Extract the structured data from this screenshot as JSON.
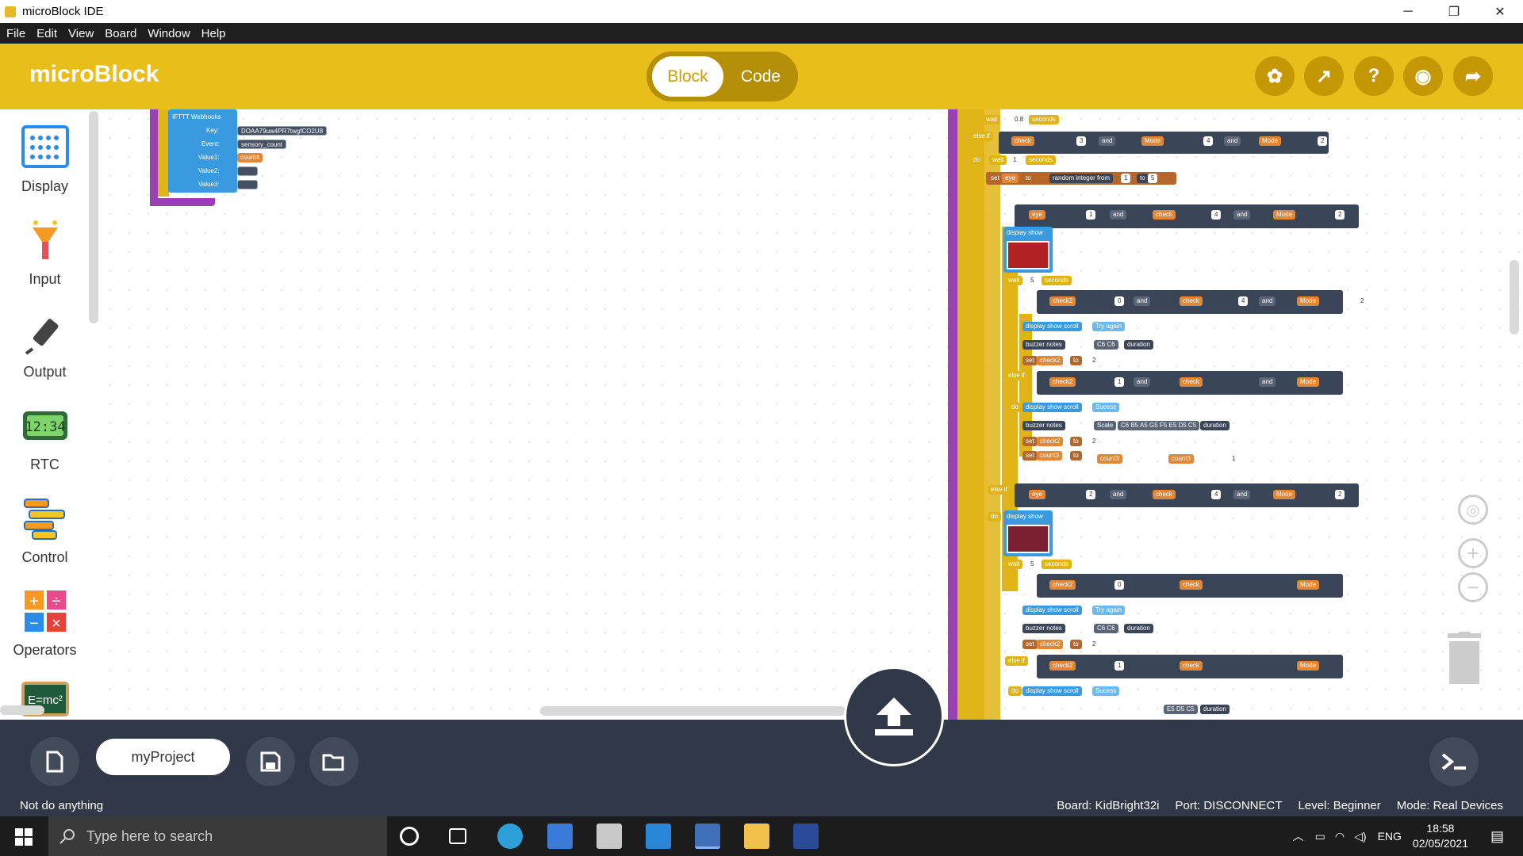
{
  "window": {
    "title": "microBlock IDE",
    "controls": [
      "─",
      "❐",
      "✕"
    ]
  },
  "menu": [
    "File",
    "Edit",
    "View",
    "Board",
    "Window",
    "Help"
  ],
  "header": {
    "logo": "microBlock",
    "mode_block": "Block",
    "mode_code": "Code",
    "tools": [
      "extensions-icon",
      "graph-icon",
      "help-icon",
      "github-icon",
      "share-icon"
    ],
    "tool_glyphs": [
      "✿",
      "↗",
      "?",
      "◉",
      "➦"
    ]
  },
  "palette": [
    {
      "label": "Display",
      "icon": "display-icon"
    },
    {
      "label": "Input",
      "icon": "input-icon"
    },
    {
      "label": "Output",
      "icon": "output-icon"
    },
    {
      "label": "RTC",
      "icon": "rtc-icon",
      "icon_text": "12:34"
    },
    {
      "label": "Control",
      "icon": "control-icon"
    },
    {
      "label": "Operators",
      "icon": "operators-icon"
    },
    {
      "label": "",
      "icon": "math-icon",
      "icon_text": "E=mc²"
    }
  ],
  "blocks": {
    "ifttt": {
      "title": "IFTTT Webhooks",
      "key_label": "Key:",
      "key_value": "DOAA79uw4PR7twgfCO2U8",
      "event_label": "Event:",
      "event_value": "sensory_count",
      "value1_label": "Value1:",
      "value1": "count4",
      "value2_label": "Value2:",
      "value3_label": "Value3:"
    },
    "main": {
      "wait": "wait",
      "seconds": "seconds",
      "wait_value_1": "0.8",
      "else_if": "else if",
      "do": "do",
      "and": "and",
      "set": "set",
      "to": "to",
      "check": "check",
      "mode": "Mode",
      "eye": "eye",
      "check2": "check2",
      "count3": "count3",
      "random": "random integer from",
      "rand_from": "1",
      "rand_to": "5",
      "display_show": "display show",
      "display_show_scroll": "display show scroll",
      "buzzer_notes": "buzzer notes",
      "duration": "duration",
      "try_again": "Try again",
      "sucess": "Sucess",
      "notes_1": "C6 C6",
      "notes_scale": "Scale",
      "notes_2": "C6 B5 A5 G5 F5 E5 D5 C5",
      "notes_partial": "E5 D5 C5",
      "n0": "0",
      "n1": "1",
      "n2": "2",
      "n3": "3",
      "n4": "4",
      "n5": "5"
    }
  },
  "bottom": {
    "project_name": "myProject",
    "status": "Not do anything",
    "board": "Board: KidBright32i",
    "port": "Port: DISCONNECT",
    "level": "Level: Beginner",
    "mode": "Mode: Real Devices"
  },
  "taskbar": {
    "search_placeholder": "Type here to search",
    "lang": "ENG",
    "time": "18:58",
    "date": "02/05/2021"
  }
}
